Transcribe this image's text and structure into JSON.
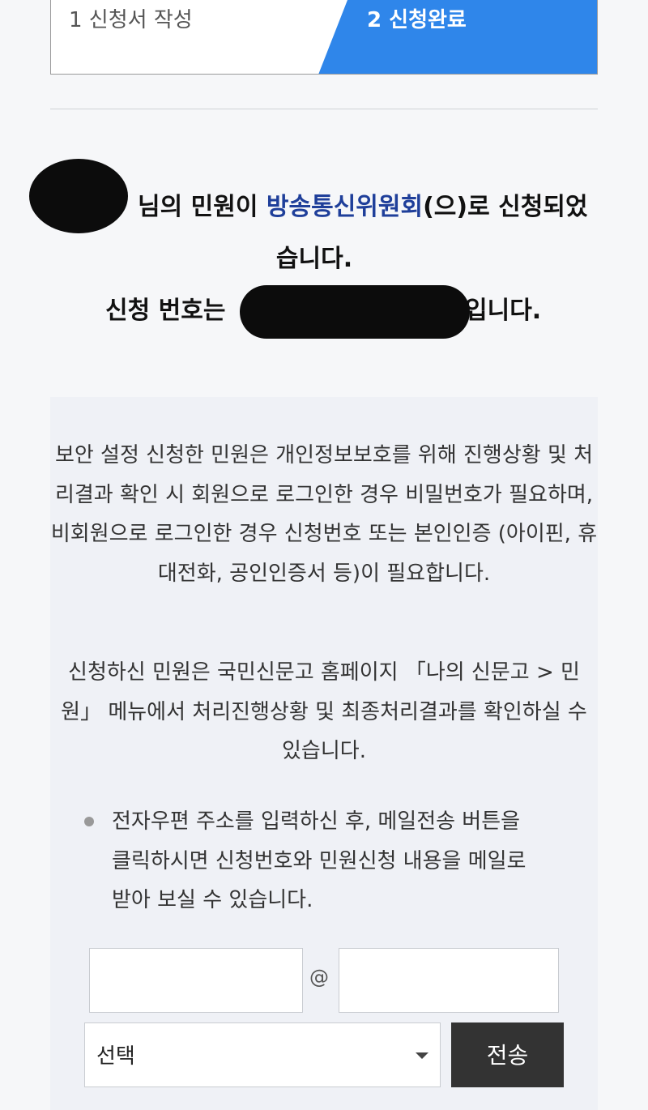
{
  "steps": {
    "step1": "1 신청서 작성",
    "step2": "2 신청완료"
  },
  "result": {
    "line1_suffix": "님의 민원이 ",
    "org": "방송통신위원회",
    "line1_tail": "(으)로 신청되었",
    "line2": "습니다.",
    "line3_pre": "신청 번호는",
    "line3_post": "입니다."
  },
  "info": {
    "para1": "보안 설정 신청한 민원은 개인정보보호를 위해 진행상황 및 처리결과 확인 시 회원으로 로그인한 경우 비밀번호가 필요하며, 비회원으로 로그인한 경우 신청번호 또는 본인인증 (아이핀, 휴대전화, 공인인증서 등)이 필요합니다.",
    "para2": "신청하신 민원은 국민신문고 홈페이지 「나의 신문고 > 민원」 메뉴에서 처리진행상황 및 최종처리결과를 확인하실 수 있습니다.",
    "bullet": "전자우편 주소를 입력하신 후, 메일전송 버튼을 클릭하시면 신청번호와 민원신청 내용을 메일로 받아 보실 수 있습니다."
  },
  "email_form": {
    "at_symbol": "@",
    "select_value": "선택",
    "send_label": "전송"
  },
  "colors": {
    "accent": "#2f86ea",
    "org_text": "#1f3f9a",
    "button_dark": "#333333"
  }
}
